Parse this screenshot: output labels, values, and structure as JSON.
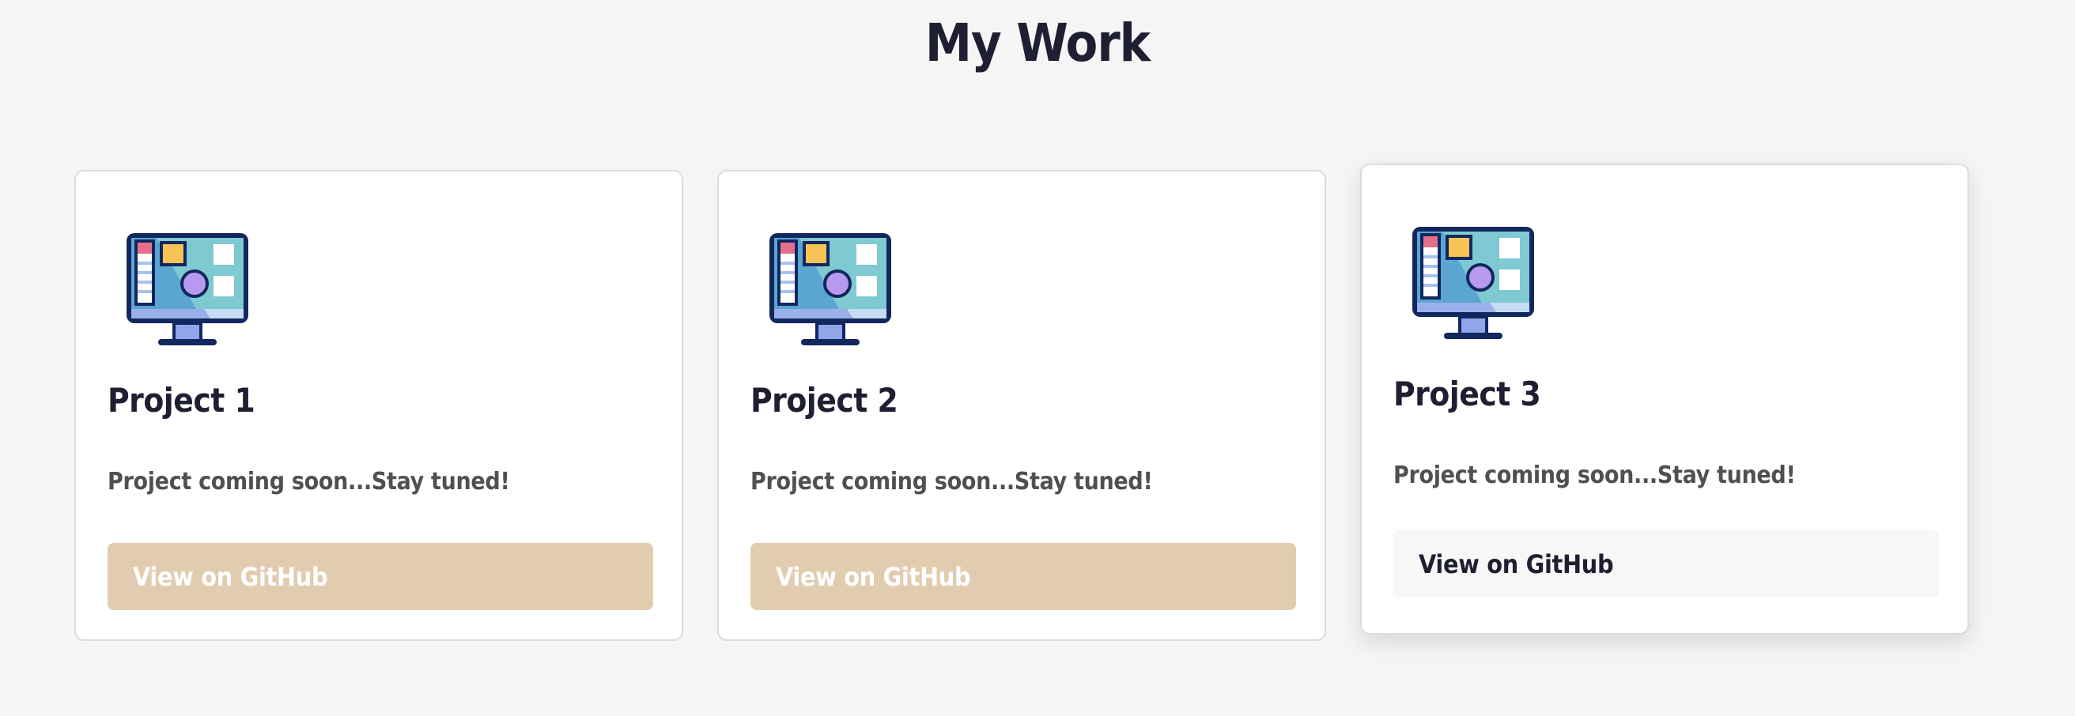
{
  "page": {
    "title": "My Work"
  },
  "projects": [
    {
      "title": "Project 1",
      "description": "Project coming soon...Stay tuned!",
      "button_label": "View on GitHub",
      "icon": "monitor-icon",
      "button_state": "normal"
    },
    {
      "title": "Project 2",
      "description": "Project coming soon...Stay tuned!",
      "button_label": "View on GitHub",
      "icon": "monitor-icon",
      "button_state": "normal"
    },
    {
      "title": "Project 3",
      "description": "Project coming soon...Stay tuned!",
      "button_label": "View on GitHub",
      "icon": "monitor-icon",
      "button_state": "hover"
    }
  ],
  "colors": {
    "background": "#f5f5f5",
    "card": "#ffffff",
    "button_normal": "#e2ccb0",
    "button_hover": "#f7f7f7",
    "text_dark": "#1f1f33",
    "text_muted": "#505050",
    "icon_outline": "#12275e"
  }
}
